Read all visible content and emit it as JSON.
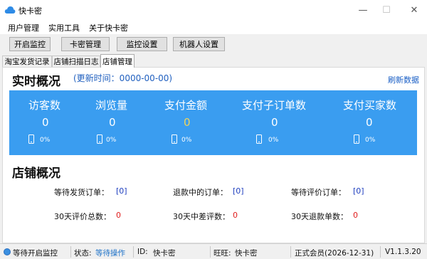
{
  "window": {
    "title": "快卡密",
    "icon": "cloud-icon",
    "controls": {
      "minimize": "—",
      "maximize": "☐",
      "close": "✕"
    }
  },
  "menu": [
    "用户管理",
    "实用工具",
    "关于快卡密"
  ],
  "toolbar": [
    "开启监控",
    "卡密管理",
    "监控设置",
    "机器人设置"
  ],
  "tabs": [
    {
      "label": "淘宝发货记录",
      "active": false
    },
    {
      "label": "店铺扫描日志",
      "active": false
    },
    {
      "label": "店铺管理",
      "active": true
    }
  ],
  "realtime": {
    "title": "实时概况",
    "update_label": "(更新时间：0000-00-00)",
    "refresh": "刷新数据",
    "accent_color": "#3a9df0",
    "stats": [
      {
        "label": "访客数",
        "value": "0",
        "pct": "0%"
      },
      {
        "label": "浏览量",
        "value": "0",
        "pct": "0%"
      },
      {
        "label": "支付金额",
        "value": "0",
        "pct": "0%",
        "highlight_color": "#f0d45a"
      },
      {
        "label": "支付子订单数",
        "value": "0",
        "pct": "0%"
      },
      {
        "label": "支付买家数",
        "value": "0",
        "pct": "0%"
      }
    ]
  },
  "store": {
    "title": "店铺概况",
    "rows": [
      [
        {
          "label": "等待发货订单：",
          "value": "[0]"
        },
        {
          "label": "退款中的订单：",
          "value": "[0]"
        },
        {
          "label": "等待评价订单：",
          "value": "[0]"
        }
      ],
      [
        {
          "label": "30天评价总数：",
          "value": "0"
        },
        {
          "label": "30天中差评数：",
          "value": "0"
        },
        {
          "label": "30天退款单数：",
          "value": "0"
        }
      ]
    ]
  },
  "status": {
    "monitor": "等待开启监控",
    "state_label": "状态:",
    "state_value": "等待操作",
    "id_label": "ID:",
    "id_value": "快卡密",
    "wangwang_label": "旺旺:",
    "wangwang_value": "快卡密",
    "member": "正式会员(2026-12-31)",
    "version": "V1.1.3.20"
  }
}
